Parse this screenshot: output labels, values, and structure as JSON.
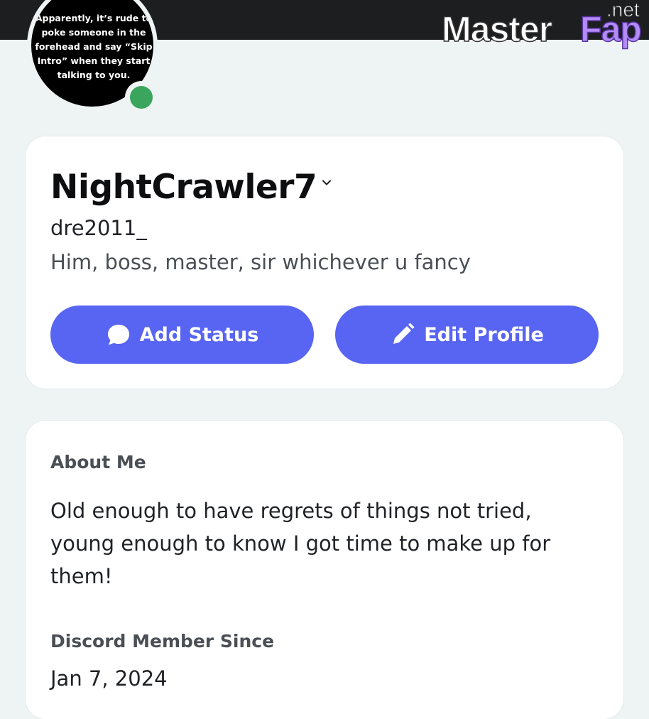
{
  "avatar": {
    "caption": "Apparently, it’s rude to poke someone in the forehead and say “Skip Intro” when they start talking to you.",
    "status": "online",
    "status_color": "#3aa55c"
  },
  "watermark": {
    "part1": "Master",
    "part2": "Fap",
    "tld": ".net"
  },
  "profile": {
    "display_name": "NightCrawler7",
    "username": "dre2011_",
    "pronouns": "Him, boss, master, sir whichever u fancy",
    "add_status_label": "Add Status",
    "edit_profile_label": "Edit Profile",
    "add_status_icon": "speech-bubble-icon",
    "edit_profile_icon": "pencil-icon",
    "button_color": "#5865f2"
  },
  "about": {
    "heading": "About Me",
    "text": "Old enough to have regrets of things not tried, young enough to know I got time to make up for them!",
    "member_since_heading": "Discord Member Since",
    "member_since_date": "Jan 7, 2024"
  }
}
